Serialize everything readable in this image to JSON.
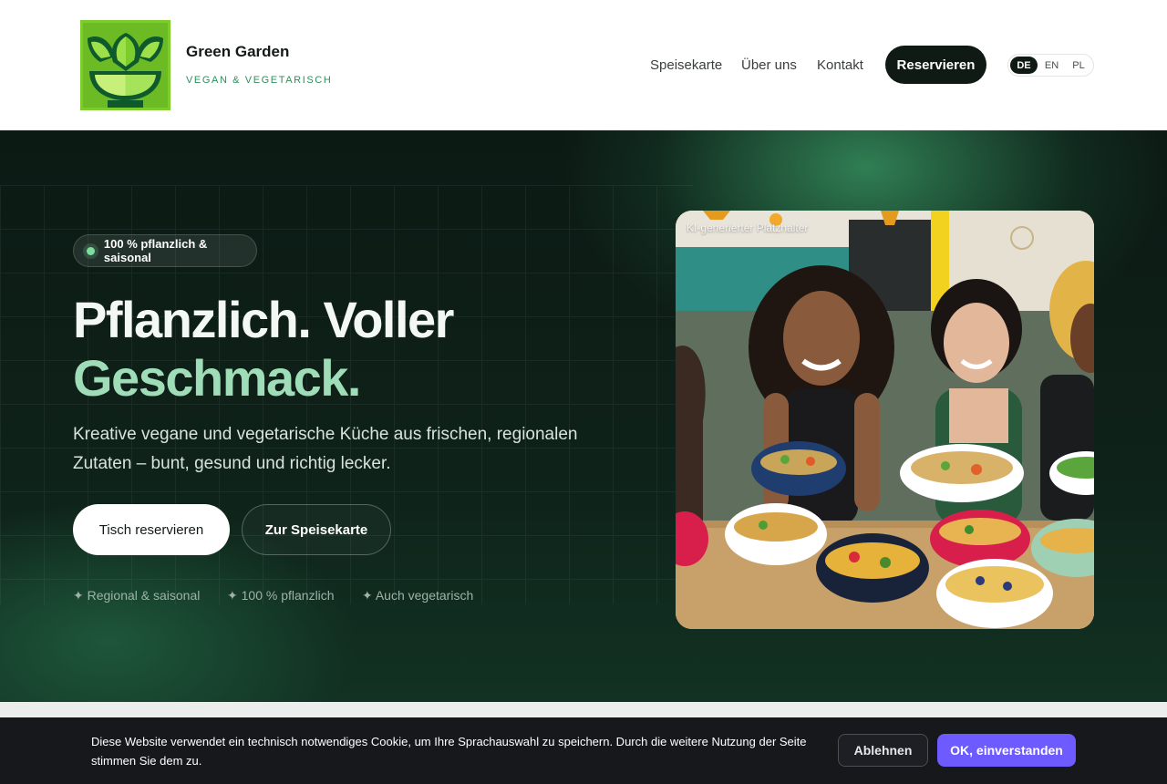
{
  "brand": {
    "name": "Green Garden",
    "tagline": "VEGAN & VEGETARISCH"
  },
  "nav": {
    "items": [
      "Speisekarte",
      "Über uns",
      "Kontakt"
    ],
    "cta": "Reservieren"
  },
  "languages": {
    "options": [
      "DE",
      "EN",
      "PL"
    ],
    "active": "DE"
  },
  "hero": {
    "badge": "100 % pflanzlich & saisonal",
    "headline_line1": "Pflanzlich. Voller",
    "headline_line2": "Geschmack.",
    "lead": "Kreative vegane und vegetarische Küche aus frischen, regionalen Zutaten – bunt, gesund und richtig lecker.",
    "primary_button": "Tisch reservieren",
    "secondary_button": "Zur Speisekarte",
    "features": [
      "✦ Regional & saisonal",
      "✦ 100 % pflanzlich",
      "✦ Auch vegetarisch"
    ],
    "image_label": "KI-generierter Platzhalter"
  },
  "cookie": {
    "text": "Diese Website verwendet ein technisch notwendiges Cookie, um Ihre Sprachauswahl zu speichern. Durch die weitere Nutzung der Seite stimmen Sie dem zu.",
    "decline": "Ablehnen",
    "accept": "OK, einverstanden"
  },
  "colors": {
    "brand_dark": "#0f1a14",
    "accent_green": "#9fdcb8",
    "cookie_accept": "#6e5bff"
  }
}
